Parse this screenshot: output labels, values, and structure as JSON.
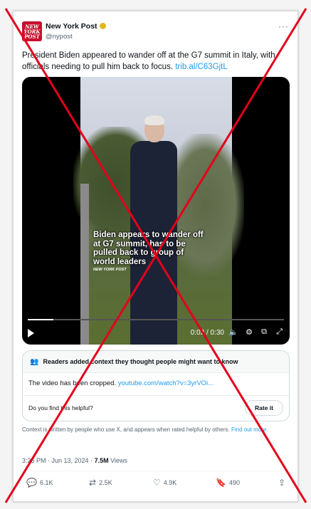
{
  "post": {
    "author_name": "New York Post",
    "handle": "@nypost",
    "avatar_text": "NEW YORK POST",
    "more_label": "···",
    "text": "President Biden appeared to wander off at the G7 summit in Italy, with officials needing to pull him back to focus.",
    "link": "trib.al/C63GjtL"
  },
  "video": {
    "caption": "Biden appears to wander off at G7 summit, has to be pulled back to group of world leaders",
    "caption_source": "NEW YORK POST",
    "time": "0:03 / 0:30",
    "progress": 0.1
  },
  "context": {
    "header": "Readers added context they thought people might want to know",
    "body": "The video has been cropped.",
    "body_link": "youtube.com/watch?v=3yrVOi...",
    "helpful_question": "Do you find this helpful?",
    "rate_button": "Rate it",
    "note": "Context is written by people who use X, and appears when rated helpful by others.",
    "find_out_more": "Find out more."
  },
  "meta": {
    "timestamp": "3:26 PM · Jun 13, 2024 ·",
    "views_count": "7.5M",
    "views_label": "Views"
  },
  "actions": {
    "replies": "6.1K",
    "reposts": "2.5K",
    "likes": "4.9K",
    "bookmarks": "490"
  },
  "colors": {
    "link": "#1d9bf0",
    "x_mark": "#e3001b"
  }
}
